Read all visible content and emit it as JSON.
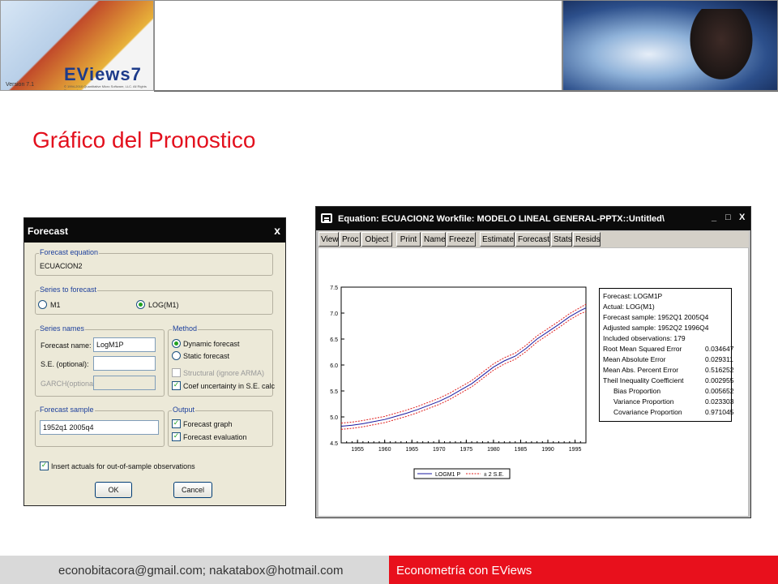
{
  "header": {
    "logo": {
      "brand": "EViews7",
      "version": "Version 7.1",
      "copyright": "© 1994-2010 Quantitative Micro Software, LLC. All Rights Reserved."
    }
  },
  "page_title": "Gráfico del Pronostico",
  "forecast_dialog": {
    "title": "Forecast",
    "close": "x",
    "equation_group": "Forecast equation",
    "equation_value": "ECUACION2",
    "series_group": "Series to forecast",
    "series_options": [
      "M1",
      "LOG(M1)"
    ],
    "series_selected": "LOG(M1)",
    "names_group": "Series names",
    "forecast_name_label": "Forecast name:",
    "forecast_name_value": "LogM1P",
    "se_label": "S.E. (optional):",
    "se_value": "",
    "garch_label": "GARCH(optional):",
    "garch_value": "",
    "method_group": "Method",
    "method_options": [
      "Dynamic forecast",
      "Static forecast"
    ],
    "method_selected": "Dynamic forecast",
    "structural_label": "Structural (ignore ARMA)",
    "structural_checked": false,
    "coef_label": "Coef uncertainty in S.E. calc",
    "coef_checked": true,
    "sample_group": "Forecast sample",
    "sample_value": "1952q1 2005q4",
    "output_group": "Output",
    "output_graph_label": "Forecast graph",
    "output_graph_checked": true,
    "output_eval_label": "Forecast evaluation",
    "output_eval_checked": true,
    "insert_label": "Insert actuals for out-of-sample observations",
    "insert_checked": true,
    "ok_label": "OK",
    "cancel_label": "Cancel"
  },
  "equation_window": {
    "title": "Equation: ECUACION2   Workfile: MODELO LINEAL GENERAL-PPTX::Untitled\\",
    "controls": [
      "_",
      "□",
      "X"
    ],
    "toolbar": [
      "View",
      "Proc",
      "Object",
      "Print",
      "Name",
      "Freeze",
      "Estimate",
      "Forecast",
      "Stats",
      "Resids"
    ],
    "stats": [
      {
        "label": "Forecast: LOGM1P",
        "value": "",
        "indent": false
      },
      {
        "label": "Actual: LOG(M1)",
        "value": "",
        "indent": false
      },
      {
        "label": "Forecast sample: 1952Q1 2005Q4",
        "value": "",
        "indent": false
      },
      {
        "label": "Adjusted sample: 1952Q2 1996Q4",
        "value": "",
        "indent": false
      },
      {
        "label": "Included observations: 179",
        "value": "",
        "indent": false
      },
      {
        "label": "Root Mean Squared Error",
        "value": "0.034647",
        "indent": false
      },
      {
        "label": "Mean Absolute Error",
        "value": "0.029311",
        "indent": false
      },
      {
        "label": "Mean Abs. Percent Error",
        "value": "0.516252",
        "indent": false
      },
      {
        "label": "Theil Inequality Coefficient",
        "value": "0.002955",
        "indent": false
      },
      {
        "label": "Bias Proportion",
        "value": "0.005652",
        "indent": true
      },
      {
        "label": "Variance Proportion",
        "value": "0.023303",
        "indent": true
      },
      {
        "label": "Covariance Proportion",
        "value": "0.971045",
        "indent": true
      }
    ]
  },
  "chart_data": {
    "type": "line",
    "x": [
      1952,
      1954,
      1956,
      1958,
      1960,
      1962,
      1964,
      1966,
      1968,
      1970,
      1972,
      1974,
      1976,
      1978,
      1980,
      1982,
      1984,
      1986,
      1988,
      1990,
      1992,
      1994,
      1996,
      1997
    ],
    "series": [
      {
        "name": "LOGM1P",
        "color": "#1a1aa0",
        "values": [
          4.82,
          4.84,
          4.87,
          4.91,
          4.95,
          5.01,
          5.07,
          5.14,
          5.22,
          5.3,
          5.4,
          5.52,
          5.64,
          5.8,
          5.96,
          6.08,
          6.17,
          6.32,
          6.5,
          6.64,
          6.78,
          6.93,
          7.05,
          7.1
        ]
      },
      {
        "name": "± 2 S.E.",
        "color": "#e0201e",
        "values": [
          4.88,
          4.9,
          4.93,
          4.97,
          5.01,
          5.07,
          5.13,
          5.2,
          5.28,
          5.36,
          5.46,
          5.58,
          5.7,
          5.86,
          6.02,
          6.14,
          6.23,
          6.38,
          6.56,
          6.7,
          6.84,
          6.99,
          7.11,
          7.17
        ]
      },
      {
        "name": "",
        "color": "#e0201e",
        "values": [
          4.76,
          4.78,
          4.81,
          4.85,
          4.89,
          4.95,
          5.01,
          5.08,
          5.16,
          5.24,
          5.34,
          5.46,
          5.58,
          5.74,
          5.9,
          6.02,
          6.11,
          6.26,
          6.44,
          6.58,
          6.72,
          6.87,
          6.99,
          7.03
        ]
      }
    ],
    "xticks": [
      1955,
      1960,
      1965,
      1970,
      1975,
      1980,
      1985,
      1990,
      1995
    ],
    "yticks": [
      "4.5",
      "5.0",
      "5.5",
      "6.0",
      "6.5",
      "7.0",
      "7.5"
    ],
    "xlim": [
      1952,
      1997
    ],
    "ylim": [
      4.5,
      7.5
    ],
    "legend": [
      "LOGM1 P",
      "± 2 S.E."
    ],
    "legend_position": "bottom"
  },
  "footer": {
    "emails": "econobitacora@gmail.com;  nakatabox@hotmail.com",
    "course": "Econometría con EViews"
  }
}
